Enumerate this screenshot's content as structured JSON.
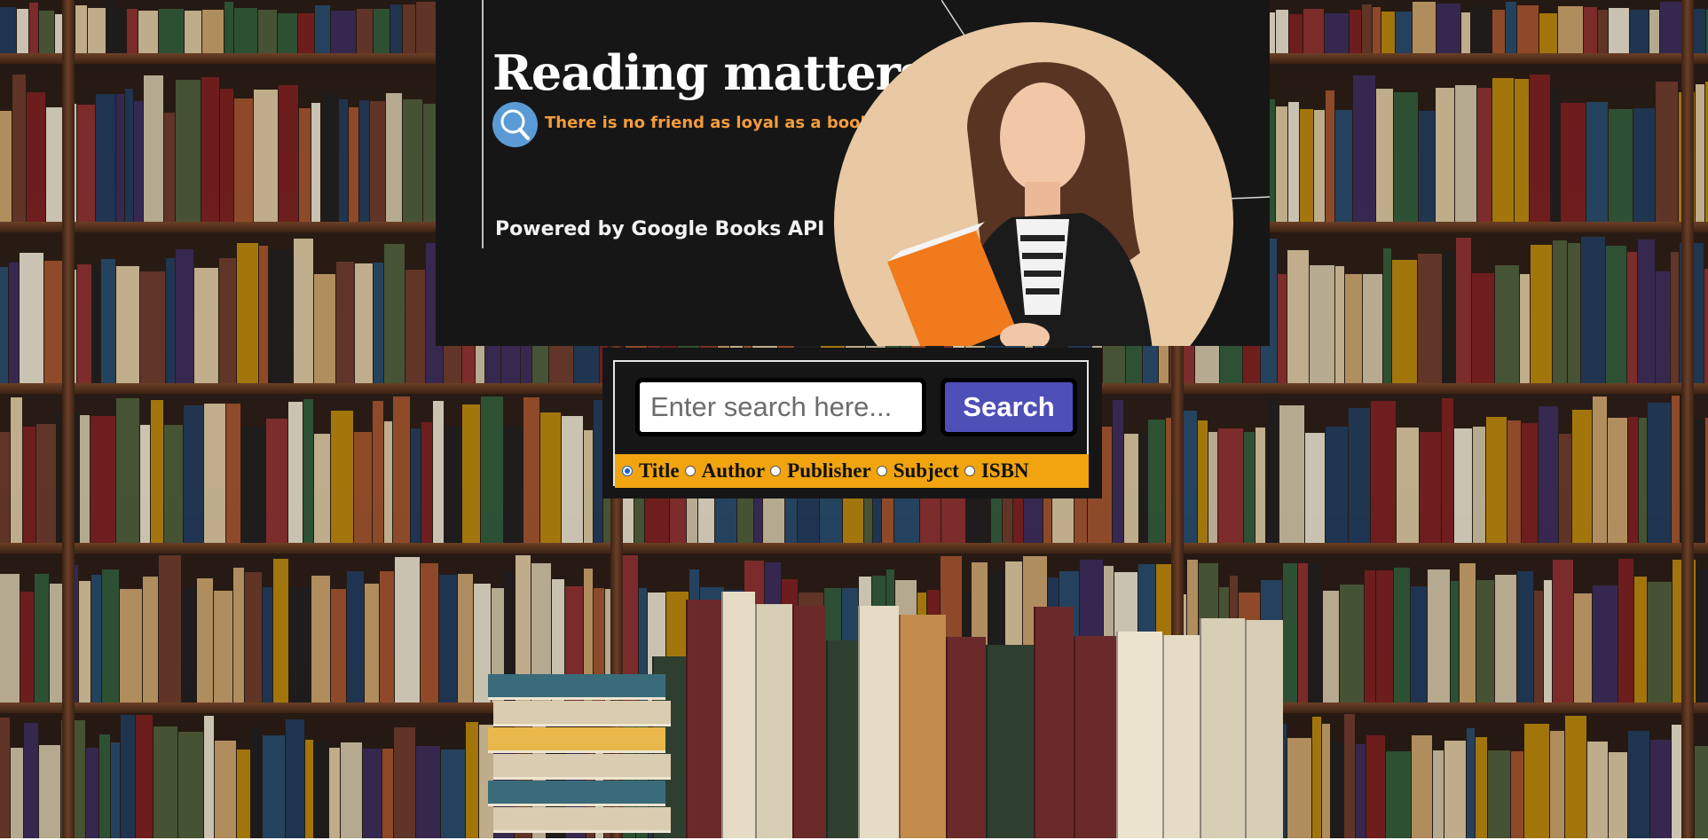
{
  "hero": {
    "title": "Reading matters",
    "tagline": "There is no friend as loyal as a book",
    "powered_by": "Powered by Google Books API",
    "icon": "search-icon",
    "colors": {
      "background": "#161616",
      "title": "#ffffff",
      "tagline": "#f39c3c",
      "icon_bg": "#5b9bd5"
    }
  },
  "search": {
    "placeholder": "Enter search here...",
    "button_label": "Search",
    "colors": {
      "button": "#4f4fb8",
      "filter_bar": "#f1a40e"
    },
    "filters": [
      {
        "label": "Title",
        "checked": true
      },
      {
        "label": "Author",
        "checked": false
      },
      {
        "label": "Publisher",
        "checked": false
      },
      {
        "label": "Subject",
        "checked": false
      },
      {
        "label": "ISBN",
        "checked": false
      }
    ]
  }
}
